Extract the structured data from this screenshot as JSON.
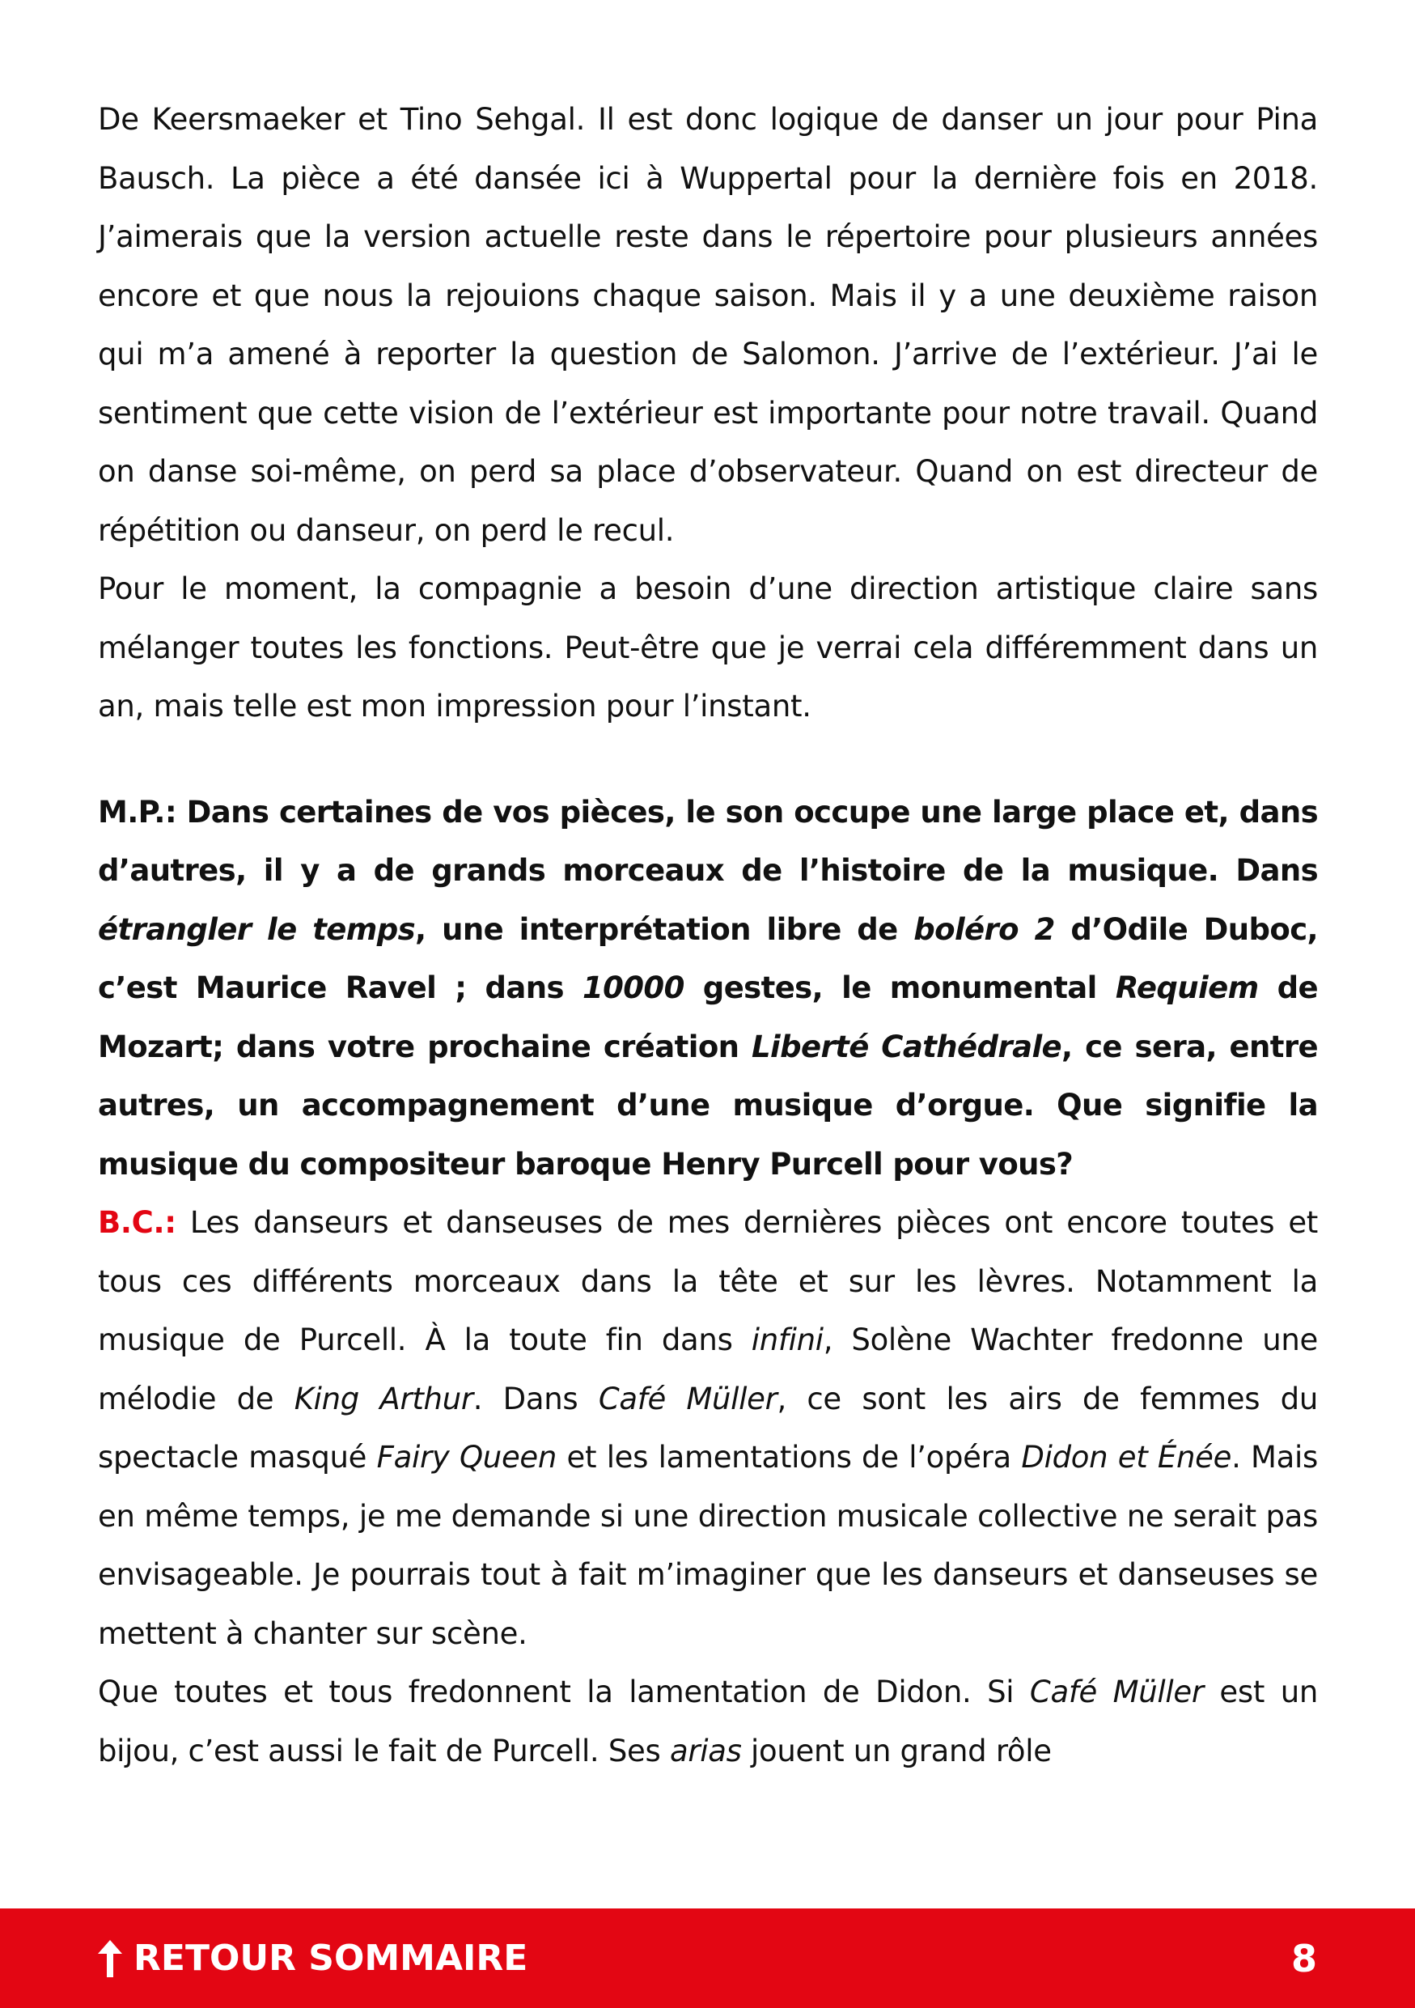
{
  "paragraphs": {
    "p1": "De Keersmaeker et Tino Sehgal. Il est donc logique de danser un jour pour Pina Bausch. La pièce a été dansée ici à Wuppertal pour la dernière fois en 2018. J’aimerais que la version actuelle reste dans le répertoire pour plusieurs années encore et que nous la rejouions chaque saison. Mais il y a une deuxième raison qui m’a amené à reporter la question de Salomon. J’arrive de l’extérieur. J’ai le sentiment que cette vision de l’extérieur est importante pour notre travail. Quand on danse soi-même, on perd sa place d’observateur. Quand on est directeur de répétition ou danseur, on perd le recul.",
    "p2": "Pour le moment, la compagnie a besoin d’une direction artistique claire sans mélanger toutes les fonctions. Peut-être que je verrai cela différemment dans un an, mais telle est mon impression pour l’instant."
  },
  "question": {
    "t1": "M.P.: Dans certaines de vos pièces, le son occupe une large place et, dans d’autres, il y a de grands morceaux de l’histoire de la musique. Dans ",
    "i1": "étrangler le temps",
    "t2": ", une interprétation libre de ",
    "i2": "boléro 2",
    "t3": " d’Odile Duboc, c’est Maurice Ravel ; dans ",
    "i3": "10000",
    "t4": " gestes, le monumental ",
    "i4": "Requiem",
    "t5": " de Mozart; dans votre prochaine création ",
    "i5": "Liberté Cathédrale",
    "t6": ", ce sera, entre autres, un accompagnement d’une musique d’orgue. Que signifie la musique du compositeur baroque Henry Purcell pour vous?"
  },
  "answer": {
    "speaker": "B.C.:",
    "t1": " Les danseurs et danseuses de mes dernières pièces ont encore toutes et tous ces différents morceaux dans la tête et sur les lèvres. Notamment la musique de Purcell. À la toute fin dans ",
    "i1": "infini",
    "t2": ", Solène Wachter fredonne une mélodie de ",
    "i2": "King Arthur",
    "t3": ". Dans ",
    "i3": "Café Müller",
    "t4": ", ce sont les airs de femmes du spectacle masqué ",
    "i4": "Fairy Queen",
    "t5": " et les lamentations de l’opéra ",
    "i5": "Didon et Énée",
    "t6": ". Mais en même temps, je me demande si une direction musicale collective ne serait pas envisageable. Je pourrais tout à fait m’imaginer que les danseurs et danseuses se mettent à chanter sur scène."
  },
  "last": {
    "t1": "Que toutes et tous fredonnent la lamentation de Didon. Si ",
    "i1": "Café Müller",
    "t2": " est un bijou, c’est aussi le fait de Purcell. Ses ",
    "i2": "arias",
    "t3": " jouent un grand rôle"
  },
  "footer": {
    "link_label": "RETOUR SOMMAIRE",
    "arrow_icon": "arrow-up-icon",
    "page_number": "8",
    "background_color": "#e30613"
  }
}
